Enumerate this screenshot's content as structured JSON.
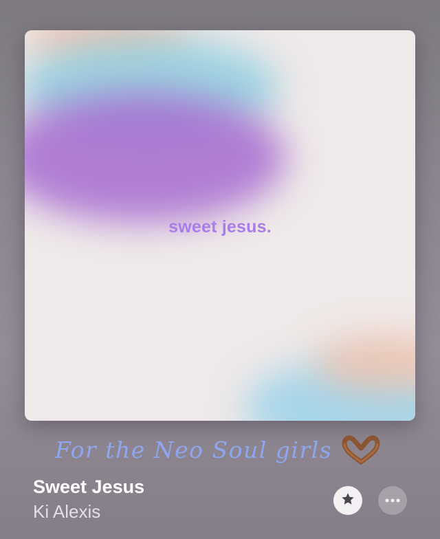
{
  "album": {
    "art_text": "sweet jesus."
  },
  "caption": {
    "text": "For the Neo Soul girls",
    "emoji_icon": "heart-hands-icon"
  },
  "track": {
    "title": "Sweet Jesus",
    "artist": "Ki Alexis"
  },
  "actions": {
    "favorite_icon": "star-icon",
    "more_icon": "ellipsis-icon"
  },
  "colors": {
    "caption": "#8ea6ef",
    "album_text": "#a87de9",
    "art_background": "#efe9e9"
  }
}
